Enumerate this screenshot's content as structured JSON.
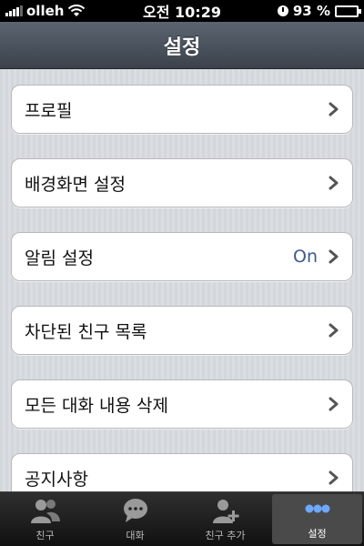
{
  "status_bar": {
    "carrier": "olleh",
    "time": "오전 10:29",
    "battery": "93 %",
    "battery_level": 0.93
  },
  "nav": {
    "title": "설정"
  },
  "settings": [
    {
      "label": "프로필",
      "value": ""
    },
    {
      "label": "배경화면 설정",
      "value": ""
    },
    {
      "label": "알림 설정",
      "value": "On"
    },
    {
      "label": "차단된 친구 목록",
      "value": ""
    },
    {
      "label": "모든 대화 내용 삭제",
      "value": ""
    },
    {
      "label": "공지사항",
      "value": ""
    }
  ],
  "tabs": [
    {
      "label": "친구",
      "icon": "friends-icon",
      "active": false
    },
    {
      "label": "대화",
      "icon": "chat-icon",
      "active": false
    },
    {
      "label": "친구 추가",
      "icon": "add-friend-icon",
      "active": false
    },
    {
      "label": "설정",
      "icon": "more-icon",
      "active": true
    }
  ],
  "colors": {
    "accent_value": "#3d5a8a",
    "nav_bg": "#4a525c",
    "tab_active": "#4a4a4a"
  }
}
